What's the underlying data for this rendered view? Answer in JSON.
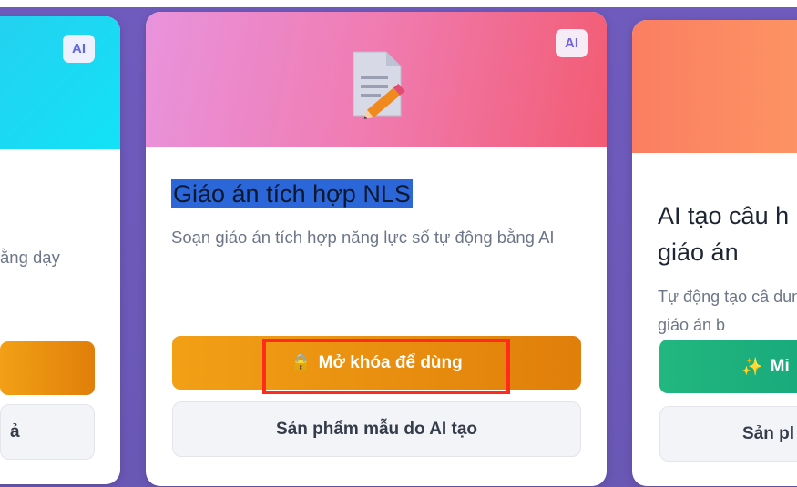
{
  "cards": {
    "left": {
      "ai_badge": "AI",
      "desc_fragment": "ằng dạy",
      "secondary_fragment": "ả"
    },
    "middle": {
      "ai_badge": "AI",
      "icon": "document-edit-icon",
      "title": "Giáo án tích hợp NLS",
      "description": "Soạn giáo án tích hợp năng lực số tự động bằng AI",
      "unlock_button": "Mở khóa để dùng",
      "unlock_icon": "lock-icon",
      "sample_button": "Sản phẩm mẫu do AI tạo"
    },
    "right": {
      "title": "AI tạo câu h giáo án",
      "description": "Tự động tạo câ dung giáo án b",
      "primary_button": "Mi",
      "primary_icon": "sparkles-icon",
      "sample_button": "Sản pl"
    }
  },
  "colors": {
    "background": "#6c5bb8",
    "highlight_border": "#ff2b1c",
    "primary_orange": "#f2a016",
    "primary_green": "#22b680"
  }
}
